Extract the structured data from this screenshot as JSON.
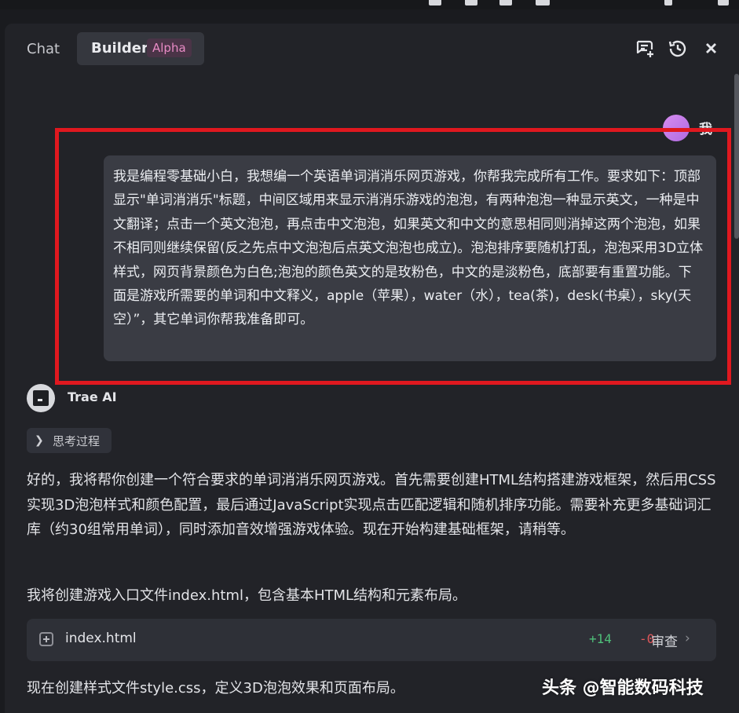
{
  "header": {
    "tab_chat": "Chat",
    "tab_builder": "Builder",
    "builder_badge": "Alpha"
  },
  "user_message": {
    "name": "我",
    "text": "我是编程零基础小白，我想编一个英语单词消消乐网页游戏，你帮我完成所有工作。要求如下：顶部显示\"单词消消乐\"标题，中间区域用来显示消消乐游戏的泡泡，有两种泡泡一种显示英文，一种是中文翻译；点击一个英文泡泡，再点击中文泡泡，如果英文和中文的意思相同则消掉这两个泡泡，如果不相同则继续保留(反之先点中文泡泡后点英文泡泡也成立)。泡泡排序要随机打乱，泡泡采用3D立体样式，网页背景颜色为白色;泡泡的颜色英文的是玫粉色，中文的是淡粉色，底部要有重置功能。下面是游戏所需要的单词和中文释义，apple（苹果），water（水），tea(茶)，desk(书桌），sky(天空）”，其它单词你帮我准备即可。"
  },
  "assistant": {
    "name": "Trae AI",
    "thinking_label": "思考过程",
    "para1": "好的，我将帮你创建一个符合要求的单词消消乐网页游戏。首先需要创建HTML结构搭建游戏框架，然后用CSS实现3D泡泡样式和颜色配置，最后通过JavaScript实现点击匹配逻辑和随机排序功能。需要补充更多基础词汇库（约30组常用单词），同时添加音效增强游戏体验。现在开始构建基础框架，请稍等。",
    "para2": "我将创建游戏入口文件index.html，包含基本HTML结构和元素布局。",
    "file": {
      "name": "index.html",
      "added": "+14",
      "removed": "-0",
      "review_label": "审查"
    },
    "para3": "现在创建样式文件style.css，定义3D泡泡效果和页面布局。"
  },
  "watermark": "头条 @智能数码科技",
  "colors": {
    "highlight_frame": "#e0181f",
    "badge_text": "#e88bc5",
    "added": "#4fbf79",
    "removed": "#e0575a"
  },
  "icons": [
    "new-chat-icon",
    "history-icon",
    "close-icon",
    "chevron-right-icon",
    "plus-square-icon"
  ]
}
